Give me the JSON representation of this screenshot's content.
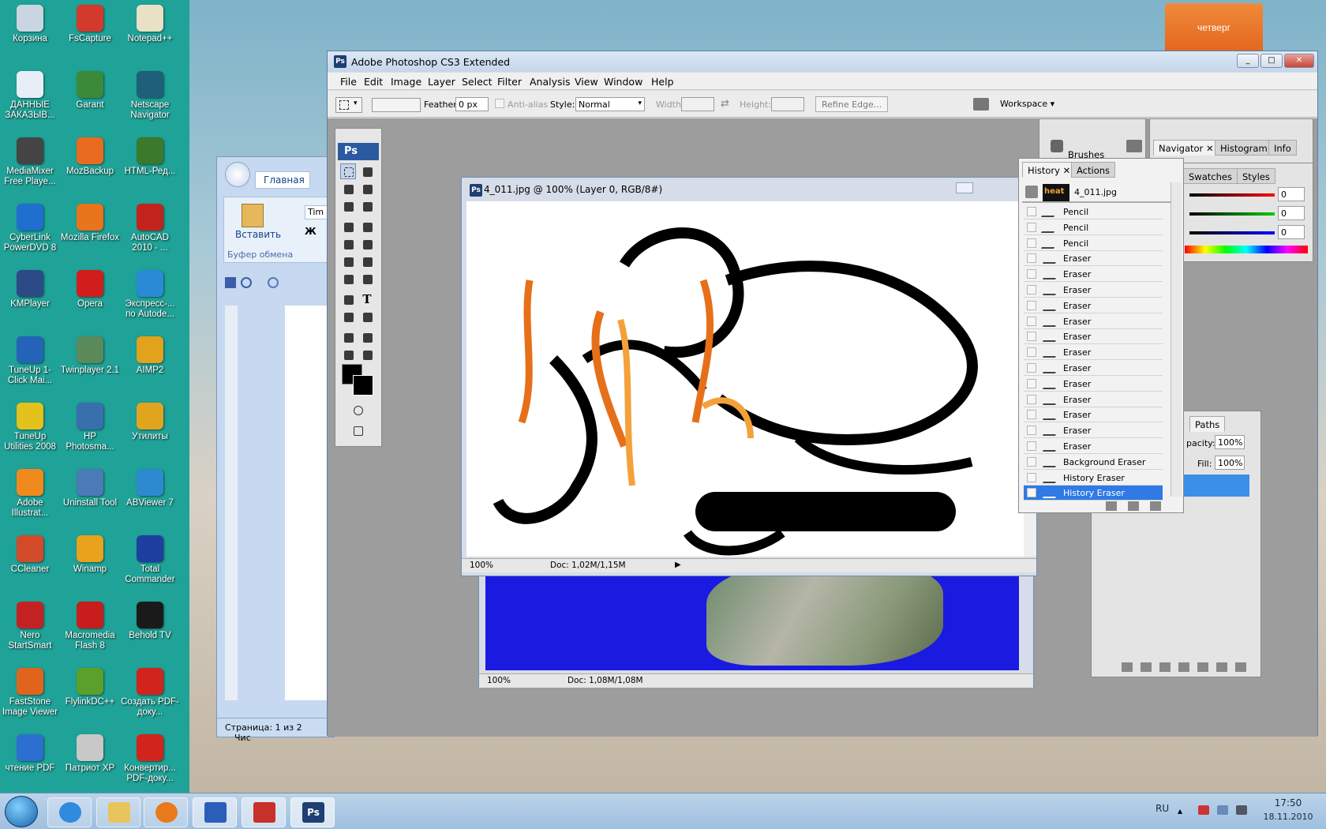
{
  "desktop": {
    "icons": [
      {
        "label": "Корзина",
        "color": "#c9d6e2"
      },
      {
        "label": "FsCapture",
        "color": "#d33a2c"
      },
      {
        "label": "Notepad++",
        "color": "#e8e1c6"
      },
      {
        "label": "ДАННЫЕ ЗАКАЗЫВ...",
        "color": "#e8eef6"
      },
      {
        "label": "Garant",
        "color": "#3b8a3a"
      },
      {
        "label": "Netscape Navigator",
        "color": "#1f5f7a"
      },
      {
        "label": "MediaMixer Free Playe...",
        "color": "#444444"
      },
      {
        "label": "MozBackup",
        "color": "#e96b1f"
      },
      {
        "label": "HTML-Ред...",
        "color": "#3b7a2a"
      },
      {
        "label": "CyberLink PowerDVD 8",
        "color": "#1f6fd0"
      },
      {
        "label": "Mozilla Firefox",
        "color": "#e8741c"
      },
      {
        "label": "AutoCAD 2010 - ...",
        "color": "#c2241d"
      },
      {
        "label": "KMPlayer",
        "color": "#2b4a86"
      },
      {
        "label": "Opera",
        "color": "#d21d1d"
      },
      {
        "label": "Экспресс-... по Autode...",
        "color": "#2b8ad6"
      },
      {
        "label": "TuneUp 1-Click Mai...",
        "color": "#2464b8"
      },
      {
        "label": "Twinplayer 2.1",
        "color": "#5b8a5b"
      },
      {
        "label": "AIMP2",
        "color": "#e2a21c"
      },
      {
        "label": "TuneUp Utilities 2008",
        "color": "#e4c21c"
      },
      {
        "label": "HP Photosma...",
        "color": "#3a6fae"
      },
      {
        "label": "Утилиты",
        "color": "#e0a51c"
      },
      {
        "label": "Adobe Illustrat...",
        "color": "#f08a1c"
      },
      {
        "label": "Uninstall Tool",
        "color": "#4a7ab8"
      },
      {
        "label": "ABViewer 7",
        "color": "#2e8ad0"
      },
      {
        "label": "CCleaner",
        "color": "#d24a2a"
      },
      {
        "label": "Winamp",
        "color": "#e8a21c"
      },
      {
        "label": "Total Commander",
        "color": "#1f3fa0"
      },
      {
        "label": "Nero StartSmart",
        "color": "#c42222"
      },
      {
        "label": "Macromedia Flash 8",
        "color": "#c81d1d"
      },
      {
        "label": "Behold TV",
        "color": "#1a1a1a"
      },
      {
        "label": "FastStone Image Viewer",
        "color": "#e1641c"
      },
      {
        "label": "FlylinkDC++",
        "color": "#5aa02a"
      },
      {
        "label": "Создать PDF-доку...",
        "color": "#d1241d"
      },
      {
        "label": "чтение PDF",
        "color": "#2d6fd0"
      },
      {
        "label": "Патриот XP",
        "color": "#c8c8c8"
      },
      {
        "label": "Конвертир... PDF-доку...",
        "color": "#d1241d"
      }
    ]
  },
  "calendar": {
    "weekday": "четверг"
  },
  "word": {
    "tab_home": "Главная",
    "paste_label": "Вставить",
    "clipboard_group": "Буфер обмена",
    "font_field": "Tim",
    "bold_glyph": "Ж",
    "status_page": "Страница: 1 из 2",
    "status_words": "Чис"
  },
  "photoshop": {
    "title": "Adobe Photoshop CS3 Extended",
    "menu": [
      "File",
      "Edit",
      "Image",
      "Layer",
      "Select",
      "Filter",
      "Analysis",
      "View",
      "Window",
      "Help"
    ],
    "options": {
      "feather_label": "Feather:",
      "feather_value": "0 px",
      "antialias_label": "Anti-alias",
      "style_label": "Style:",
      "style_value": "Normal",
      "width_label": "Width:",
      "height_label": "Height:",
      "refine_edge": "Refine Edge...",
      "workspace": "Workspace"
    },
    "toolbox_header": "Ps",
    "doc_front": {
      "title": "4_011.jpg @ 100% (Layer 0, RGB/8#)",
      "zoom": "100%",
      "docsize": "Doc: 1,02M/1,15M"
    },
    "doc_back": {
      "zoom": "100%",
      "docsize": "Doc: 1,08M/1,08M"
    },
    "panels": {
      "brushes": "Brushes",
      "navigator_tabs": [
        "Navigator",
        "Histogram",
        "Info"
      ],
      "color_tabs": [
        "Swatches",
        "Styles"
      ],
      "color_values": [
        "0",
        "0",
        "0"
      ],
      "layers_tab": "Paths",
      "opacity_label": "pacity:",
      "opacity_value": "100%",
      "fill_label": "Fill:",
      "fill_value": "100%"
    },
    "history": {
      "tabs": [
        "History",
        "Actions"
      ],
      "snapshot": "4_011.jpg",
      "snapshot_thumb_text": "heat",
      "items": [
        "Pencil",
        "Pencil",
        "Pencil",
        "Eraser",
        "Eraser",
        "Eraser",
        "Eraser",
        "Eraser",
        "Eraser",
        "Eraser",
        "Eraser",
        "Eraser",
        "Eraser",
        "Eraser",
        "Eraser",
        "Eraser",
        "Background Eraser",
        "History Eraser",
        "History Eraser"
      ],
      "selected_index": 18
    }
  },
  "taskbar": {
    "lang": "RU",
    "time": "17:50",
    "date": "18.11.2010",
    "ps_label": "Ps"
  },
  "colors": {
    "desktop": "#1fa297",
    "selection": "#2f7ae5",
    "ps_dark": "#1e3f73",
    "blue_fill": "#1a1ae0"
  }
}
